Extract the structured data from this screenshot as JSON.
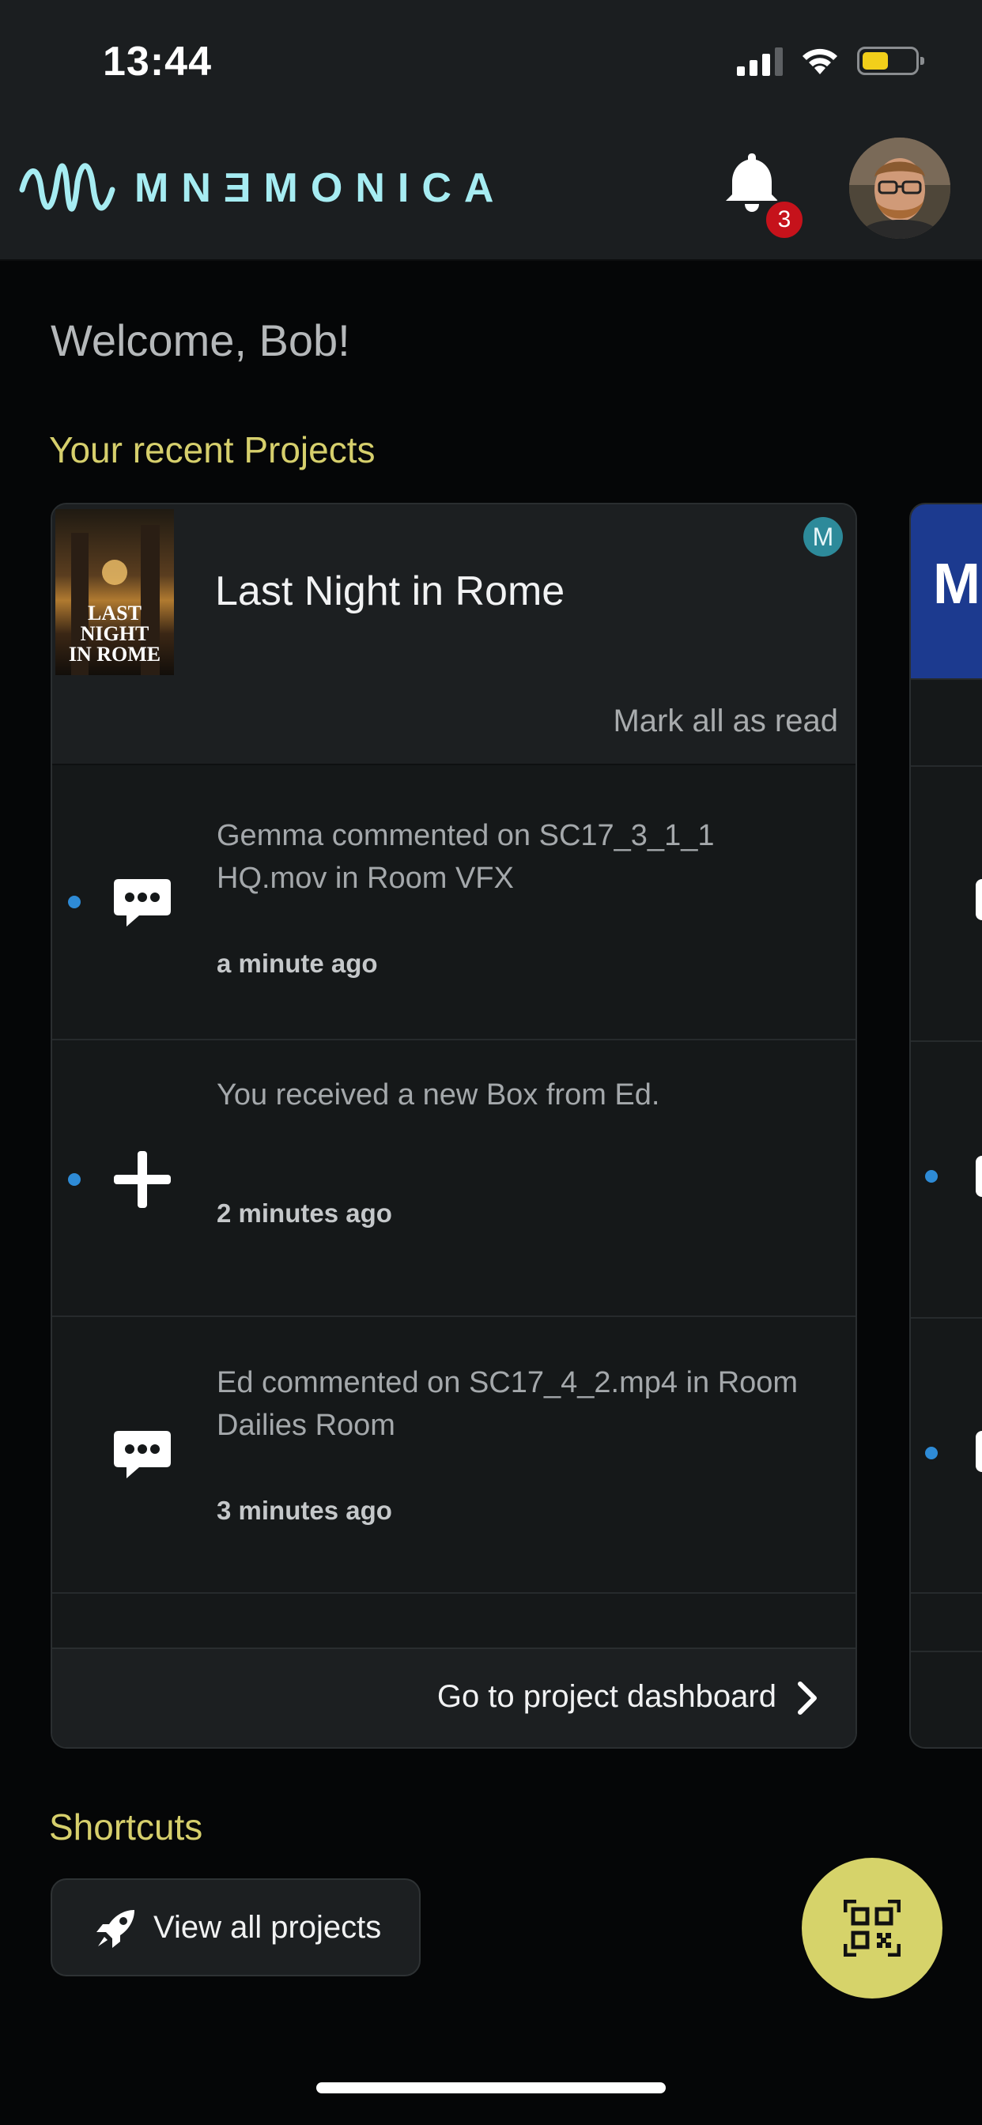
{
  "status_bar": {
    "time": "13:44",
    "battery_level": 0.45,
    "battery_color": "#f2cf1a",
    "signal_bars": 3
  },
  "header": {
    "logo_text": "MNƎMONICA",
    "notification_count": "3",
    "icons": [
      "bell-icon",
      "avatar"
    ]
  },
  "welcome": "Welcome, Bob!",
  "recent_projects_title": "Your recent Projects",
  "project": {
    "name": "Last Night in Rome",
    "badge_letter": "M",
    "mark_all_read": "Mark all as read",
    "notifications": [
      {
        "text": "Gemma commented on SC17_3_1_1 HQ.mov in Room VFX",
        "time": "a minute ago",
        "icon": "comment-icon",
        "unread": true
      },
      {
        "text": "You received a new Box from Ed.",
        "time": "2 minutes ago",
        "icon": "plus-icon",
        "unread": true
      },
      {
        "text": "Ed commented on SC17_4_2.mp4 in Room Dailies Room",
        "time": "3 minutes ago",
        "icon": "comment-icon",
        "unread": false
      }
    ],
    "dashboard_link": "Go to project dashboard"
  },
  "next_project": {
    "poster_text": "Ma"
  },
  "shortcuts_title": "Shortcuts",
  "shortcuts": {
    "view_all_projects": "View all projects",
    "icon": "rocket-icon"
  },
  "fab": {
    "icon": "qr-code-icon",
    "color": "#d6d36a"
  },
  "colors": {
    "accent_yellow": "#d6cf6c",
    "unread_dot": "#2e8bd6",
    "badge_red": "#c6121b",
    "logo_cyan": "#a6ecf2"
  }
}
